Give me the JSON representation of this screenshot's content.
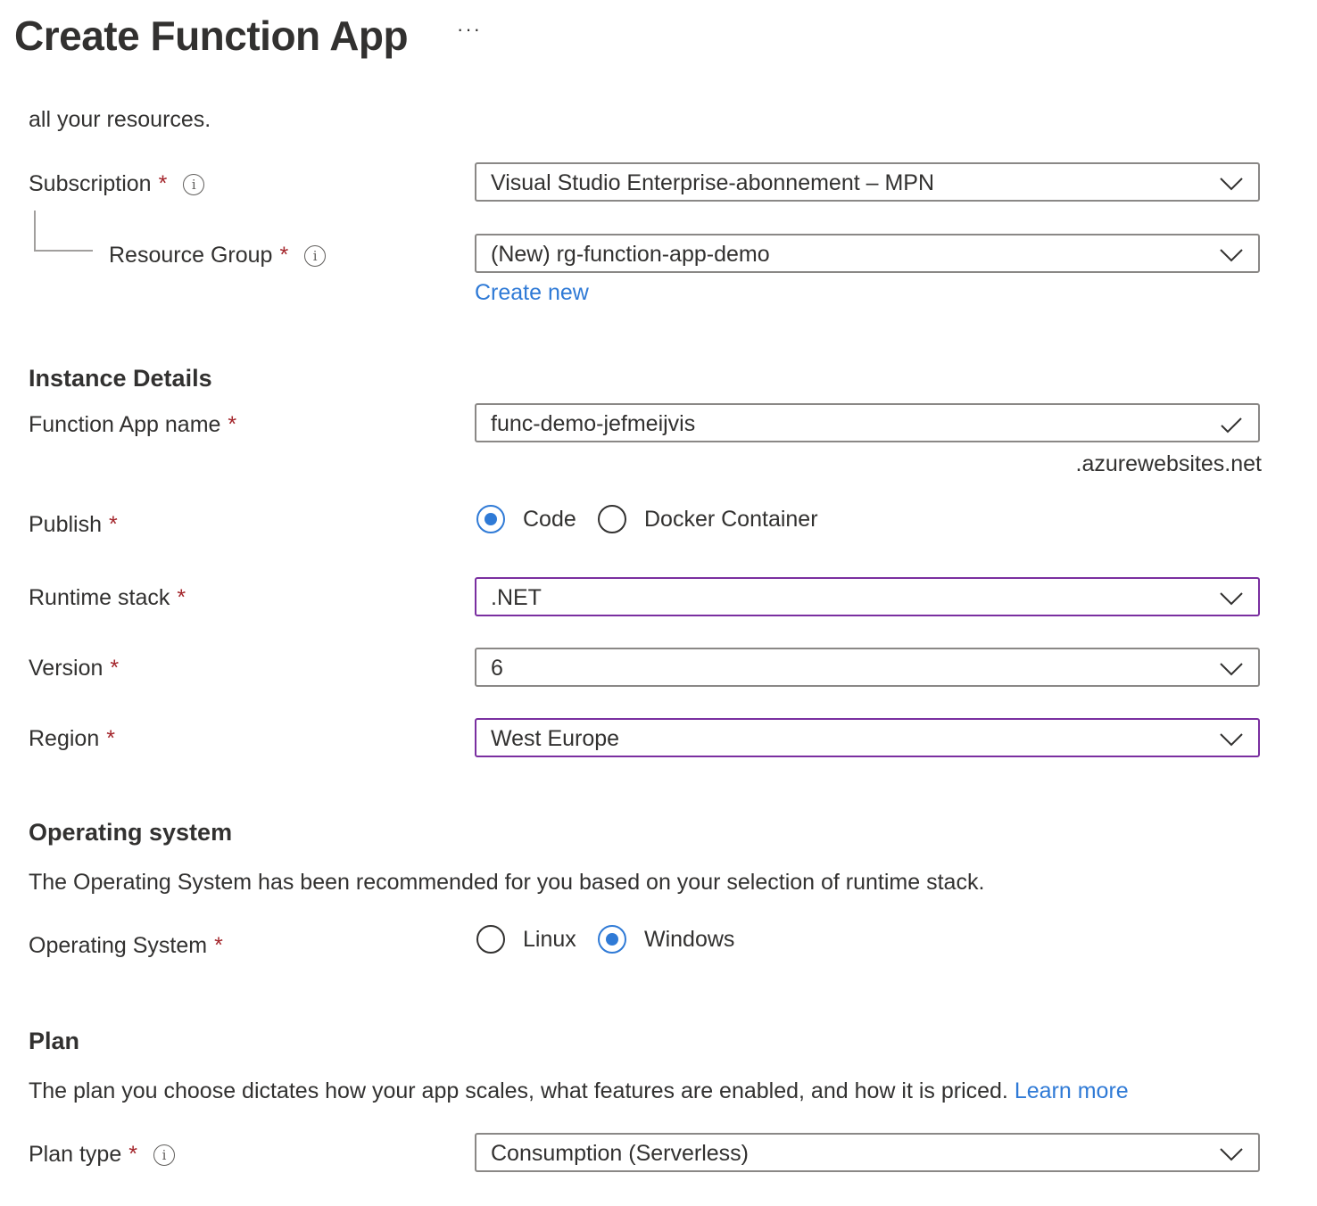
{
  "header": {
    "title": "Create Function App",
    "more_label": "···"
  },
  "intro_text": "all your resources.",
  "project": {
    "subscription": {
      "label": "Subscription",
      "required": "*",
      "info_icon": "i",
      "value": "Visual Studio Enterprise-abonnement – MPN"
    },
    "resource_group": {
      "label": "Resource Group",
      "required": "*",
      "info_icon": "i",
      "value": "(New) rg-function-app-demo",
      "create_new_label": "Create new"
    }
  },
  "instance": {
    "heading": "Instance Details",
    "function_app_name": {
      "label": "Function App name",
      "required": "*",
      "value": "func-demo-jefmeijvis",
      "suffix": ".azurewebsites.net",
      "valid": true
    },
    "publish": {
      "label": "Publish",
      "required": "*",
      "options": [
        {
          "label": "Code",
          "selected": true
        },
        {
          "label": "Docker Container",
          "selected": false
        }
      ]
    },
    "runtime_stack": {
      "label": "Runtime stack",
      "required": "*",
      "value": ".NET"
    },
    "version": {
      "label": "Version",
      "required": "*",
      "value": "6"
    },
    "region": {
      "label": "Region",
      "required": "*",
      "value": "West Europe"
    }
  },
  "os": {
    "heading": "Operating system",
    "description": "The Operating System has been recommended for you based on your selection of runtime stack.",
    "field": {
      "label": "Operating System",
      "required": "*",
      "options": [
        {
          "label": "Linux",
          "selected": false
        },
        {
          "label": "Windows",
          "selected": true
        }
      ]
    }
  },
  "plan": {
    "heading": "Plan",
    "description": "The plan you choose dictates how your app scales, what features are enabled, and how it is priced.",
    "learn_more_label": "Learn more",
    "plan_type": {
      "label": "Plan type",
      "required": "*",
      "info_icon": "i",
      "value": "Consumption (Serverless)"
    }
  },
  "colors": {
    "accent_link": "#2f7ad6",
    "required": "#a4262c",
    "focus_border": "#7a2fa0",
    "border": "#8a8886",
    "text": "#323130"
  }
}
